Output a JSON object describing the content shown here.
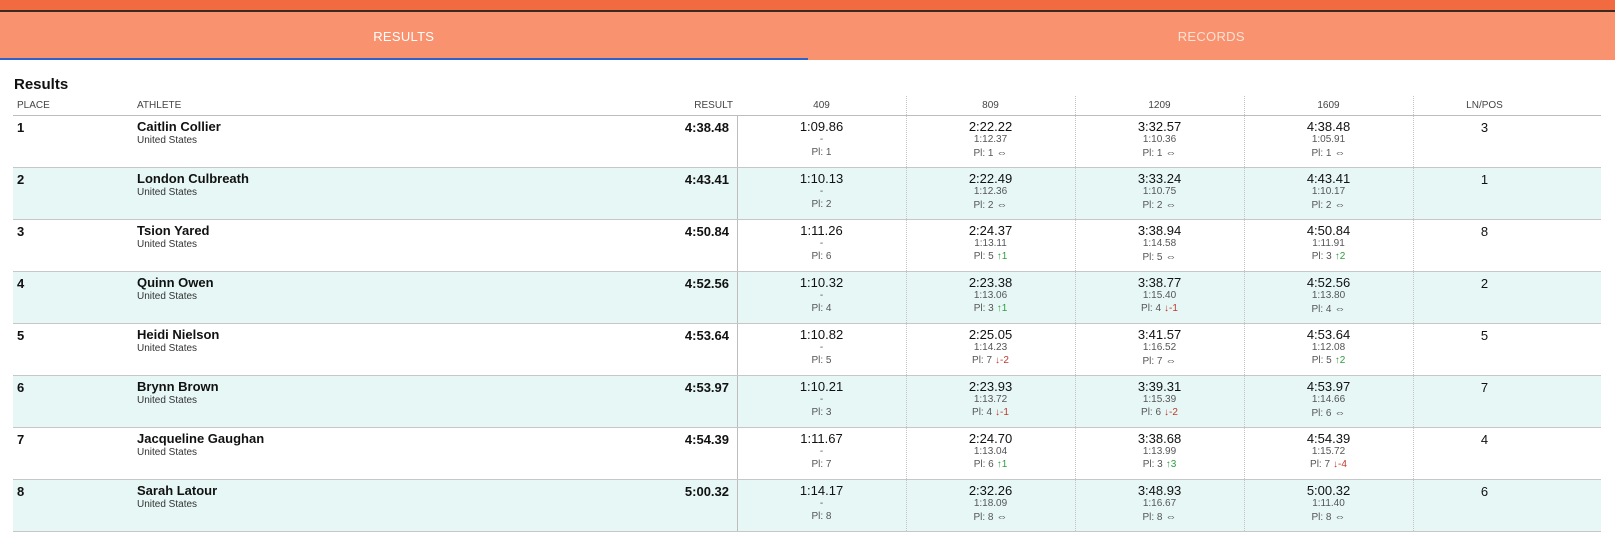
{
  "tabs": [
    {
      "label": "RESULTS",
      "active": true
    },
    {
      "label": "RECORDS",
      "active": false
    }
  ],
  "section_title": "Results",
  "headers": {
    "place": "PLACE",
    "athlete": "ATHLETE",
    "result": "RESULT",
    "splits": [
      "409",
      "809",
      "1209",
      "1609"
    ],
    "lane": "LN/POS"
  },
  "rows": [
    {
      "place": "1",
      "name": "Caitlin Collier",
      "country": "United States",
      "result": "4:38.48",
      "lane": "3",
      "splits": [
        {
          "time": "1:09.86",
          "lap": "-",
          "pl": "Pl: 1",
          "dir": "",
          "chg": ""
        },
        {
          "time": "2:22.22",
          "lap": "1:12.37",
          "pl": "Pl: 1",
          "dir": "eq",
          "chg": "⇔"
        },
        {
          "time": "3:32.57",
          "lap": "1:10.36",
          "pl": "Pl: 1",
          "dir": "eq",
          "chg": "⇔"
        },
        {
          "time": "4:38.48",
          "lap": "1:05.91",
          "pl": "Pl: 1",
          "dir": "eq",
          "chg": "⇔"
        }
      ]
    },
    {
      "place": "2",
      "name": "London Culbreath",
      "country": "United States",
      "result": "4:43.41",
      "lane": "1",
      "splits": [
        {
          "time": "1:10.13",
          "lap": "-",
          "pl": "Pl: 2",
          "dir": "",
          "chg": ""
        },
        {
          "time": "2:22.49",
          "lap": "1:12.36",
          "pl": "Pl: 2",
          "dir": "eq",
          "chg": "⇔"
        },
        {
          "time": "3:33.24",
          "lap": "1:10.75",
          "pl": "Pl: 2",
          "dir": "eq",
          "chg": "⇔"
        },
        {
          "time": "4:43.41",
          "lap": "1:10.17",
          "pl": "Pl: 2",
          "dir": "eq",
          "chg": "⇔"
        }
      ]
    },
    {
      "place": "3",
      "name": "Tsion Yared",
      "country": "United States",
      "result": "4:50.84",
      "lane": "8",
      "splits": [
        {
          "time": "1:11.26",
          "lap": "-",
          "pl": "Pl: 6",
          "dir": "",
          "chg": ""
        },
        {
          "time": "2:24.37",
          "lap": "1:13.11",
          "pl": "Pl: 5",
          "dir": "up",
          "chg": "↑1"
        },
        {
          "time": "3:38.94",
          "lap": "1:14.58",
          "pl": "Pl: 5",
          "dir": "eq",
          "chg": "⇔"
        },
        {
          "time": "4:50.84",
          "lap": "1:11.91",
          "pl": "Pl: 3",
          "dir": "up",
          "chg": "↑2"
        }
      ]
    },
    {
      "place": "4",
      "name": "Quinn Owen",
      "country": "United States",
      "result": "4:52.56",
      "lane": "2",
      "splits": [
        {
          "time": "1:10.32",
          "lap": "-",
          "pl": "Pl: 4",
          "dir": "",
          "chg": ""
        },
        {
          "time": "2:23.38",
          "lap": "1:13.06",
          "pl": "Pl: 3",
          "dir": "up",
          "chg": "↑1"
        },
        {
          "time": "3:38.77",
          "lap": "1:15.40",
          "pl": "Pl: 4",
          "dir": "down",
          "chg": "↓-1"
        },
        {
          "time": "4:52.56",
          "lap": "1:13.80",
          "pl": "Pl: 4",
          "dir": "eq",
          "chg": "⇔"
        }
      ]
    },
    {
      "place": "5",
      "name": "Heidi Nielson",
      "country": "United States",
      "result": "4:53.64",
      "lane": "5",
      "splits": [
        {
          "time": "1:10.82",
          "lap": "-",
          "pl": "Pl: 5",
          "dir": "",
          "chg": ""
        },
        {
          "time": "2:25.05",
          "lap": "1:14.23",
          "pl": "Pl: 7",
          "dir": "down",
          "chg": "↓-2"
        },
        {
          "time": "3:41.57",
          "lap": "1:16.52",
          "pl": "Pl: 7",
          "dir": "eq",
          "chg": "⇔"
        },
        {
          "time": "4:53.64",
          "lap": "1:12.08",
          "pl": "Pl: 5",
          "dir": "up",
          "chg": "↑2"
        }
      ]
    },
    {
      "place": "6",
      "name": "Brynn Brown",
      "country": "United States",
      "result": "4:53.97",
      "lane": "7",
      "splits": [
        {
          "time": "1:10.21",
          "lap": "-",
          "pl": "Pl: 3",
          "dir": "",
          "chg": ""
        },
        {
          "time": "2:23.93",
          "lap": "1:13.72",
          "pl": "Pl: 4",
          "dir": "down",
          "chg": "↓-1"
        },
        {
          "time": "3:39.31",
          "lap": "1:15.39",
          "pl": "Pl: 6",
          "dir": "down",
          "chg": "↓-2"
        },
        {
          "time": "4:53.97",
          "lap": "1:14.66",
          "pl": "Pl: 6",
          "dir": "eq",
          "chg": "⇔"
        }
      ]
    },
    {
      "place": "7",
      "name": "Jacqueline Gaughan",
      "country": "United States",
      "result": "4:54.39",
      "lane": "4",
      "splits": [
        {
          "time": "1:11.67",
          "lap": "-",
          "pl": "Pl: 7",
          "dir": "",
          "chg": ""
        },
        {
          "time": "2:24.70",
          "lap": "1:13.04",
          "pl": "Pl: 6",
          "dir": "up",
          "chg": "↑1"
        },
        {
          "time": "3:38.68",
          "lap": "1:13.99",
          "pl": "Pl: 3",
          "dir": "up",
          "chg": "↑3"
        },
        {
          "time": "4:54.39",
          "lap": "1:15.72",
          "pl": "Pl: 7",
          "dir": "down",
          "chg": "↓-4"
        }
      ]
    },
    {
      "place": "8",
      "name": "Sarah Latour",
      "country": "United States",
      "result": "5:00.32",
      "lane": "6",
      "splits": [
        {
          "time": "1:14.17",
          "lap": "-",
          "pl": "Pl: 8",
          "dir": "",
          "chg": ""
        },
        {
          "time": "2:32.26",
          "lap": "1:18.09",
          "pl": "Pl: 8",
          "dir": "eq",
          "chg": "⇔"
        },
        {
          "time": "3:48.93",
          "lap": "1:16.67",
          "pl": "Pl: 8",
          "dir": "eq",
          "chg": "⇔"
        },
        {
          "time": "5:00.32",
          "lap": "1:11.40",
          "pl": "Pl: 8",
          "dir": "eq",
          "chg": "⇔"
        }
      ]
    }
  ]
}
